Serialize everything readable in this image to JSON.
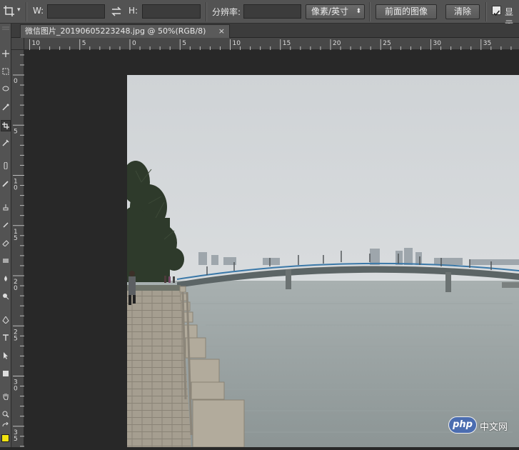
{
  "options_bar": {
    "tool_icon": "crop-icon",
    "w_label": "W:",
    "w_value": "",
    "swap_icon": "swap-arrows-icon",
    "h_label": "H:",
    "h_value": "",
    "resolution_label": "分辨率:",
    "resolution_value": "",
    "unit_select": "像素/英寸",
    "front_image_button": "前面的图像",
    "clear_button": "清除",
    "show_checkbox_label": "显示",
    "show_checkbox_checked": true
  },
  "document": {
    "tab_title": "微信图片_20190605223248.jpg @ 50%(RGB/8)",
    "close_symbol": "×"
  },
  "rulers": {
    "horizontal_labels": [
      "10",
      "5",
      "0",
      "5",
      "10",
      "15",
      "20",
      "25",
      "30",
      "35"
    ],
    "vertical_labels": [
      "0",
      "5",
      "10",
      "15",
      "20",
      "25",
      "30",
      "35"
    ]
  },
  "watermark": {
    "logo_text": "php",
    "site_text": "中文网"
  },
  "colors": {
    "panel": "#535353",
    "workspace": "#282828",
    "foreground_swatch": "#f2e410"
  }
}
